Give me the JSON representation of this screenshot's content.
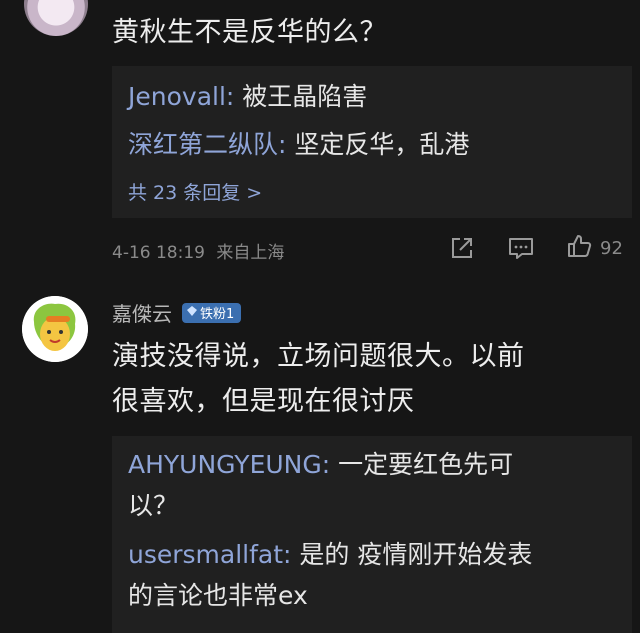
{
  "comment1": {
    "text": "黄秋生不是反华的么？",
    "replies": [
      {
        "user": "Jenovall",
        "text": "被王晶陷害"
      },
      {
        "user": "深红第二纵队",
        "text": "坚定反华，乱港"
      }
    ],
    "more_replies": "共 23 条回复 >",
    "date": "4-16 18:19",
    "location": "来自上海",
    "like_count": "92"
  },
  "comment2": {
    "username": "嘉傑云",
    "badge": "铁粉1",
    "text_line1": "演技没得说，立场问题很大。以前",
    "text_line2": "很喜欢，但是现在很讨厌",
    "replies": [
      {
        "user": "AHYUNGYEUNG",
        "text_line1": "一定要红色先可",
        "text_line2": "以？"
      },
      {
        "user": "usersmallfat",
        "text_line1": "是的 疫情刚开始发表",
        "text_line2": "的言论也非常ex"
      }
    ]
  },
  "icons": {
    "share": "share-icon",
    "comment": "comment-icon",
    "like": "thumbs-up-icon"
  },
  "colors": {
    "background": "#161616",
    "reply_box": "#202020",
    "link": "#8fa5d8",
    "badge": "#3b6fb0"
  }
}
